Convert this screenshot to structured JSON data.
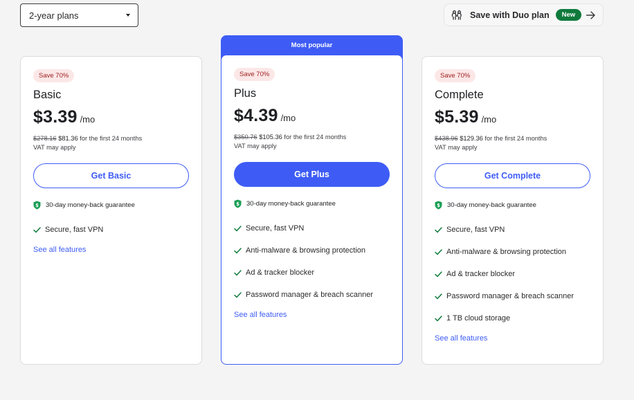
{
  "plan_selector": {
    "selected": "2-year plans"
  },
  "duo": {
    "label": "Save with Duo plan",
    "badge": "New"
  },
  "popular_label": "Most popular",
  "guarantee": "30-day money-back guarantee",
  "see_all": "See all features",
  "plans": [
    {
      "badge": "Save 70%",
      "name": "Basic",
      "price": "$3.39",
      "per": "/mo",
      "old_price": "$278.16",
      "new_price": "$81.36",
      "period": "for the first 24 months",
      "vat": "VAT may apply",
      "cta": "Get Basic",
      "features": [
        "Secure, fast VPN"
      ]
    },
    {
      "badge": "Save 70%",
      "name": "Plus",
      "price": "$4.39",
      "per": "/mo",
      "old_price": "$350.76",
      "new_price": "$105.36",
      "period": "for the first 24 months",
      "vat": "VAT may apply",
      "cta": "Get Plus",
      "features": [
        "Secure, fast VPN",
        "Anti-malware & browsing protection",
        "Ad & tracker blocker",
        "Password manager & breach scanner"
      ]
    },
    {
      "badge": "Save 70%",
      "name": "Complete",
      "price": "$5.39",
      "per": "/mo",
      "old_price": "$438.96",
      "new_price": "$129.36",
      "period": "for the first 24 months",
      "vat": "VAT may apply",
      "cta": "Get Complete",
      "features": [
        "Secure, fast VPN",
        "Anti-malware & browsing protection",
        "Ad & tracker blocker",
        "Password manager & breach scanner",
        "1 TB cloud storage"
      ]
    }
  ],
  "colors": {
    "accent": "#3e5cf5",
    "badge_bg": "#fce7e7",
    "badge_text": "#9b1c1c",
    "check": "#0f7a3c",
    "new_badge": "#0f7a3c"
  }
}
